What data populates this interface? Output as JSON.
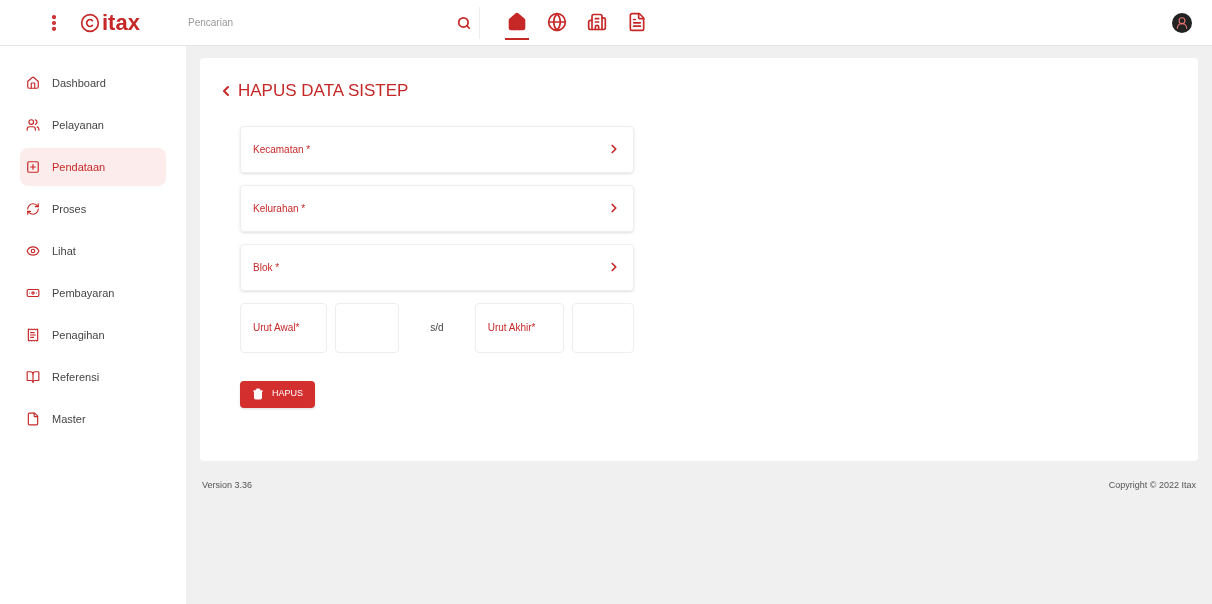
{
  "header": {
    "logo": "itax",
    "search": {
      "placeholder": "Pencarian"
    },
    "nav": [
      {
        "kind": "home",
        "selected": true
      },
      {
        "kind": "globe",
        "selected": false
      },
      {
        "kind": "building",
        "selected": false
      },
      {
        "kind": "document",
        "selected": false
      }
    ]
  },
  "sidebar": {
    "items": [
      {
        "kind": "home",
        "label": "Dashboard",
        "selected": false
      },
      {
        "kind": "users",
        "label": "Pelayanan",
        "selected": false
      },
      {
        "kind": "plus",
        "label": "Pendataan",
        "selected": true
      },
      {
        "kind": "cycle",
        "label": "Proses",
        "selected": false
      },
      {
        "kind": "eye",
        "label": "Lihat",
        "selected": false
      },
      {
        "kind": "money",
        "label": "Pembayaran",
        "selected": false
      },
      {
        "kind": "invoice",
        "label": "Penagihan",
        "selected": false
      },
      {
        "kind": "book",
        "label": "Referensi",
        "selected": false
      },
      {
        "kind": "file",
        "label": "Master",
        "selected": false
      }
    ]
  },
  "form": {
    "title": "HAPUS DATA SISTEP",
    "selects": [
      {
        "label": "Kecamatan *"
      },
      {
        "label": "Kelurahan *"
      },
      {
        "label": "Blok *"
      }
    ],
    "range": {
      "start_label": "Urut Awal*",
      "separator": "s/d",
      "end_label": "Urut Akhir*"
    },
    "button": "HAPUS"
  },
  "footer": {
    "version": "Version 3.36",
    "copyright": "Copyright © 2022 Itax"
  }
}
